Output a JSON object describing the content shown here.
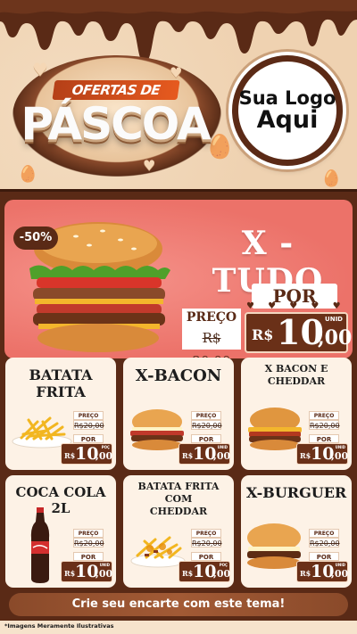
{
  "header": {
    "title_small": "OFERTAS DE",
    "title_big": "PÁSCOA",
    "logo_line1": "Sua Logo",
    "logo_line2": "Aqui"
  },
  "hero": {
    "discount": "-50%",
    "title": "X - TUDO",
    "por_label": "POR",
    "preco_label": "PREÇO",
    "old_price": "R$ 20,00",
    "currency": "R$",
    "price_int": "10",
    "price_cents": ",00",
    "unit": "UNID"
  },
  "products": [
    {
      "name": "BATATA FRITA",
      "preco_label": "PREÇO",
      "old_price": "R$20,00",
      "por_label": "POR",
      "currency": "R$",
      "price_int": "10",
      "price_cents": ",00",
      "unit": "POÇ"
    },
    {
      "name": "X-BACON",
      "preco_label": "PREÇO",
      "old_price": "R$20,00",
      "por_label": "POR",
      "currency": "R$",
      "price_int": "10",
      "price_cents": ",00",
      "unit": "UNID"
    },
    {
      "name": "X BACON E CHEDDAR",
      "preco_label": "PREÇO",
      "old_price": "R$20,00",
      "por_label": "POR",
      "currency": "R$",
      "price_int": "10",
      "price_cents": ",00",
      "unit": "UNID"
    },
    {
      "name": "COCA COLA 2L",
      "preco_label": "PREÇO",
      "old_price": "R$20,00",
      "por_label": "POR",
      "currency": "R$",
      "price_int": "10",
      "price_cents": ",00",
      "unit": "UNID"
    },
    {
      "name": "BATATA FRITA COM CHEDDAR",
      "preco_label": "PREÇO",
      "old_price": "R$20,00",
      "por_label": "POR",
      "currency": "R$",
      "price_int": "10",
      "price_cents": ",00",
      "unit": "POÇ"
    },
    {
      "name": "X-BURGUER",
      "preco_label": "PREÇO",
      "old_price": "R$20,00",
      "por_label": "POR",
      "currency": "R$",
      "price_int": "10",
      "price_cents": ",00",
      "unit": "UNID"
    }
  ],
  "footer": {
    "cta": "Crie seu encarte com este tema!",
    "disclaimer": "*Imagens Meramente Ilustrativas"
  },
  "colors": {
    "chocolate": "#5a2a16",
    "hero_bg": "#ec7269",
    "card_bg": "#fdf2e6",
    "cream": "#efd2b1"
  }
}
